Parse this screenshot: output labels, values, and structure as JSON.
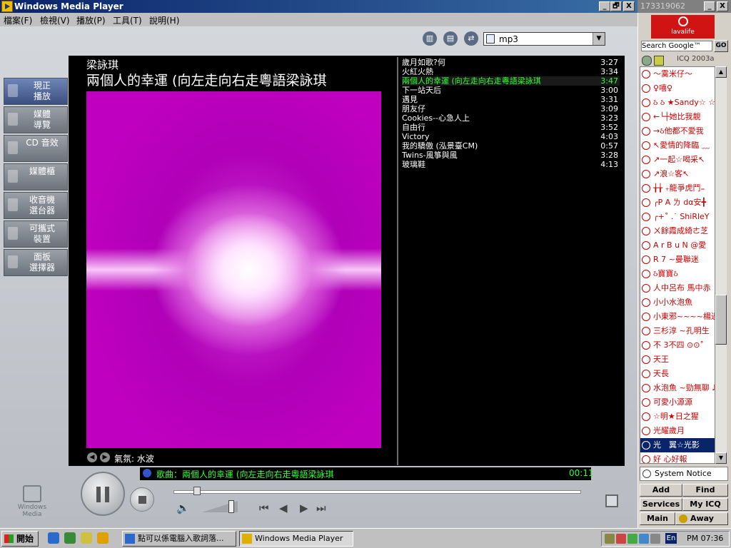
{
  "wmp": {
    "title": "Windows Media Player",
    "menu": [
      "檔案(F)",
      "檢視(V)",
      "播放(P)",
      "工具(T)",
      "說明(H)"
    ],
    "caption_buttons": [
      "_",
      "🗗",
      "X"
    ],
    "media_selector_value": "mp3",
    "nav": [
      {
        "label": "現正\n播放",
        "active": true
      },
      {
        "label": "媒體\n導覽",
        "active": false
      },
      {
        "label": "CD 音效",
        "active": false
      },
      {
        "label": "媒體櫃",
        "active": false
      },
      {
        "label": "收音機\n選台器",
        "active": false
      },
      {
        "label": "可攜式\n裝置",
        "active": false
      },
      {
        "label": "面板\n選擇器",
        "active": false
      }
    ],
    "now_playing": {
      "artist": "梁詠琪",
      "title": "兩個人的幸運 (向左走向右走粵語梁詠琪",
      "visualization_name": "氣氛: 水波"
    },
    "playlist": [
      {
        "name": "歲月如歌?何",
        "duration": "3:27",
        "current": false
      },
      {
        "name": "火紅火熱",
        "duration": "3:34",
        "current": false
      },
      {
        "name": "兩個人的幸運 (向左走向右走粵語梁詠琪",
        "duration": "3:47",
        "current": true
      },
      {
        "name": "下一站天后",
        "duration": "3:00",
        "current": false
      },
      {
        "name": "遇見",
        "duration": "3:31",
        "current": false
      },
      {
        "name": "朋友仔",
        "duration": "3:09",
        "current": false
      },
      {
        "name": "Cookies--心急人上",
        "duration": "3:23",
        "current": false
      },
      {
        "name": "自由行",
        "duration": "3:52",
        "current": false
      },
      {
        "name": "Victory",
        "duration": "4:03",
        "current": false
      },
      {
        "name": "我的驕傲 (泓景臺CM)",
        "duration": "0:57",
        "current": false
      },
      {
        "name": "Twins-風箏與風",
        "duration": "3:28",
        "current": false
      },
      {
        "name": "玻璃鞋",
        "duration": "4:13",
        "current": false
      }
    ],
    "status_text": "歌曲：兩個人的幸運 (向左走向右走粵語梁詠琪",
    "elapsed": "00:11",
    "seek_fraction": 0.05,
    "volume_fraction": 0.8,
    "logo_text": "Windows Media",
    "colors": {
      "status_green": "#33ff33",
      "viz_magenta": "#c000c0"
    }
  },
  "icq": {
    "title": "173319062",
    "ad_text": "lavalife",
    "search_label": "Search Google™",
    "go_label": "GO",
    "version": "ICQ 2003a",
    "contacts": [
      {
        "name": "～霙米仔～",
        "selected": false
      },
      {
        "name": "♀嘻♀",
        "selected": false
      },
      {
        "name": "ઠ ઠ ★Sandy☆ ☆",
        "selected": false
      },
      {
        "name": "←└┼她比我靚",
        "selected": false
      },
      {
        "name": "→ઠ他都不愛我",
        "selected": false
      },
      {
        "name": "↖愛情的降臨 ﹏",
        "selected": false
      },
      {
        "name": "↗一起☆喝采↖",
        "selected": false
      },
      {
        "name": "↗浪☆客↖",
        "selected": false
      },
      {
        "name": "╁╁ ₊龍爭虎鬥₌",
        "selected": false
      },
      {
        "name": "╭P A ㄌ dα安╋",
        "selected": false
      },
      {
        "name": "╭+˚ .˙ ShiRleY",
        "selected": false
      },
      {
        "name": "ㄨ餘霞成綺ㄜ芝",
        "selected": false
      },
      {
        "name": "A r B u N @愛",
        "selected": false
      },
      {
        "name": "R 7 ~曼聯迷",
        "selected": false
      },
      {
        "name": "ઠ寶寶ઠ",
        "selected": false
      },
      {
        "name": "人中呂布 馬中赤",
        "selected": false
      },
      {
        "name": "小小水泡魚",
        "selected": false
      },
      {
        "name": "小東邪~~~~楊過",
        "selected": false
      },
      {
        "name": "三杉淳 ~孔明生",
        "selected": false
      },
      {
        "name": "不 3不四 ⊙⊙˚",
        "selected": false
      },
      {
        "name": "天王",
        "selected": false
      },
      {
        "name": "天長",
        "selected": false
      },
      {
        "name": "水泡魚 ~勁無聊 ♪",
        "selected": false
      },
      {
        "name": "可愛小源源",
        "selected": false
      },
      {
        "name": "☆明★日之猩",
        "selected": false
      },
      {
        "name": "光耀歲月",
        "selected": false
      },
      {
        "name": "光　翼☆光影",
        "selected": true
      },
      {
        "name": "好 心好報",
        "selected": false
      }
    ],
    "system_notice": "System Notice",
    "buttons": {
      "add": "Add",
      "find_users": "Find Users",
      "services": "Services",
      "my_icq": "My ICQ",
      "main": "Main",
      "away": "Away"
    }
  },
  "taskbar": {
    "start_label": "開始",
    "tasks": [
      {
        "label": "點可以係電腦入歌詞落...",
        "active": false
      },
      {
        "label": "Windows Media Player",
        "active": true
      }
    ],
    "tray_lang": "En",
    "clock": "PM 07:36"
  }
}
